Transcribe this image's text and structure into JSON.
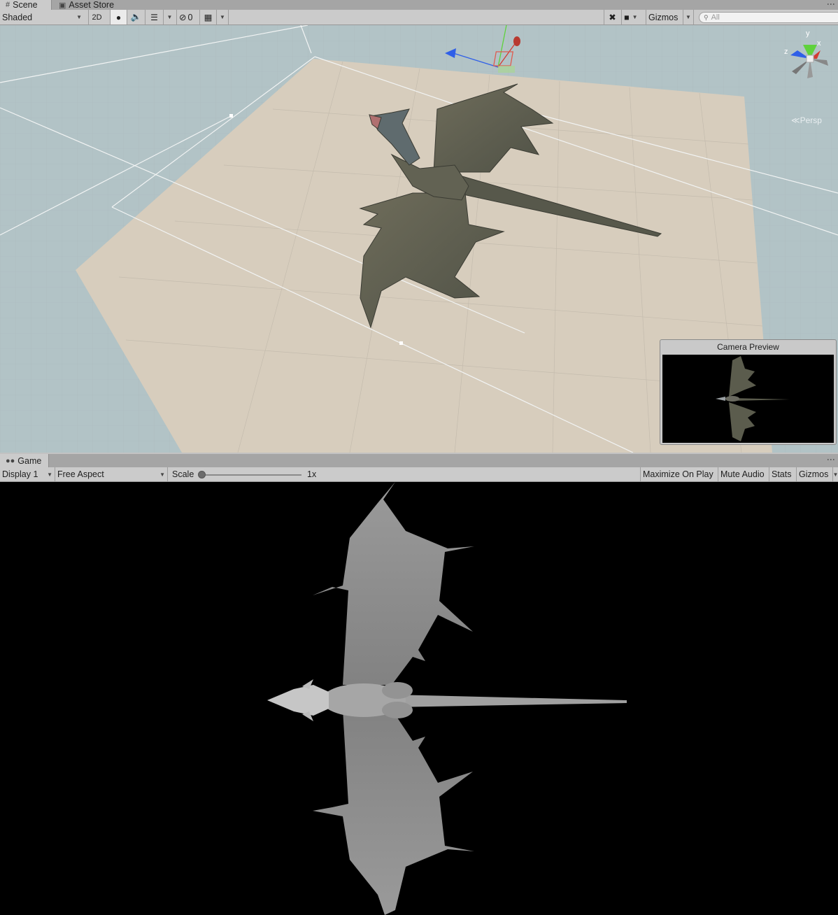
{
  "scene_tabs": [
    {
      "label": "Scene",
      "icon": "hash-icon",
      "active": true
    },
    {
      "label": "Asset Store",
      "icon": "bag-icon",
      "active": false
    }
  ],
  "scene_toolbar": {
    "shading_mode": "Shaded",
    "mode_2d": "2D",
    "hidden_count": "0",
    "gizmos_label": "Gizmos",
    "search_placeholder": "All"
  },
  "scene_view": {
    "projection_label": "Persp",
    "axis_labels": {
      "x": "x",
      "y": "y",
      "z": "z"
    }
  },
  "camera_preview": {
    "title": "Camera Preview"
  },
  "game_tab": {
    "label": "Game",
    "icon": "gamepad-icon"
  },
  "game_toolbar": {
    "display": "Display 1",
    "aspect": "Free Aspect",
    "scale_label": "Scale",
    "scale_value": "1x",
    "scale_fraction": 0.0,
    "maximize": "Maximize On Play",
    "mute": "Mute Audio",
    "stats": "Stats",
    "gizmos": "Gizmos"
  },
  "colors": {
    "sky": "#b2c3c6",
    "ground": "#d7cdbd",
    "toolbar": "#cbcbcb",
    "game_bg": "#000000",
    "dragon_scene": "#57584b",
    "dragon_game": "#8f8f8f",
    "axis_x": "#d23c32",
    "axis_y": "#5fd23c",
    "axis_z": "#2f5fe8"
  }
}
